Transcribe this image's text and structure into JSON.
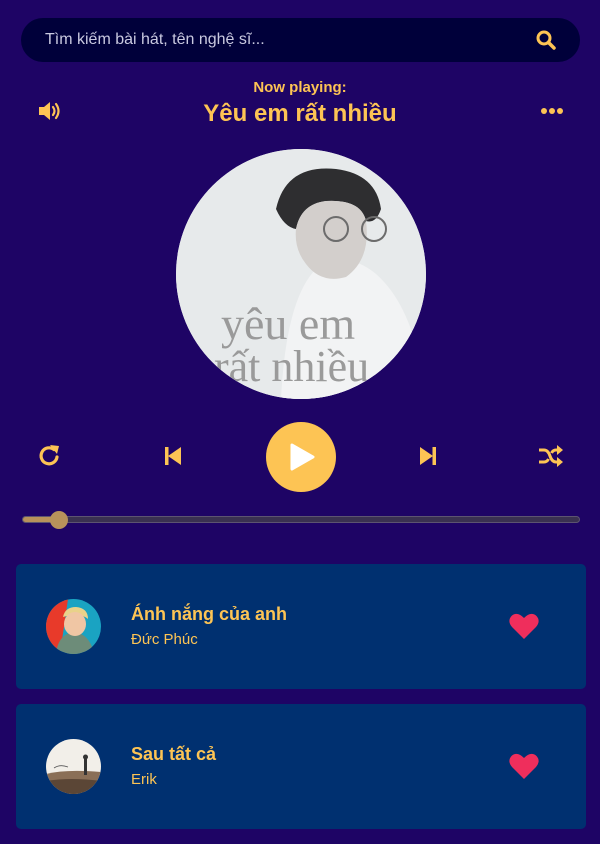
{
  "search": {
    "placeholder": "Tìm kiếm bài hát, tên nghệ sĩ...",
    "icon": "search-icon"
  },
  "header": {
    "now_label": "Now playing:",
    "song_title": "Yêu em rất nhiều",
    "volume_icon": "volume-icon",
    "more_icon": "more-icon"
  },
  "cd": {
    "art_text_top": "yêu em",
    "art_text_bottom": "rất nhiều"
  },
  "controls": {
    "icons": [
      "repeat-icon",
      "previous-icon",
      "play-icon",
      "next-icon",
      "shuffle-icon"
    ]
  },
  "progress": {
    "value_fraction": 0.065
  },
  "playlist": [
    {
      "title": "Ánh nắng của anh",
      "artist": "Đức Phúc",
      "favorite": true
    },
    {
      "title": "Sau tất cả",
      "artist": "Erik",
      "favorite": true
    }
  ],
  "colors": {
    "background": "#1e0465",
    "accent": "#fdc454",
    "card": "#003070",
    "heart": "#ef2e5c"
  }
}
